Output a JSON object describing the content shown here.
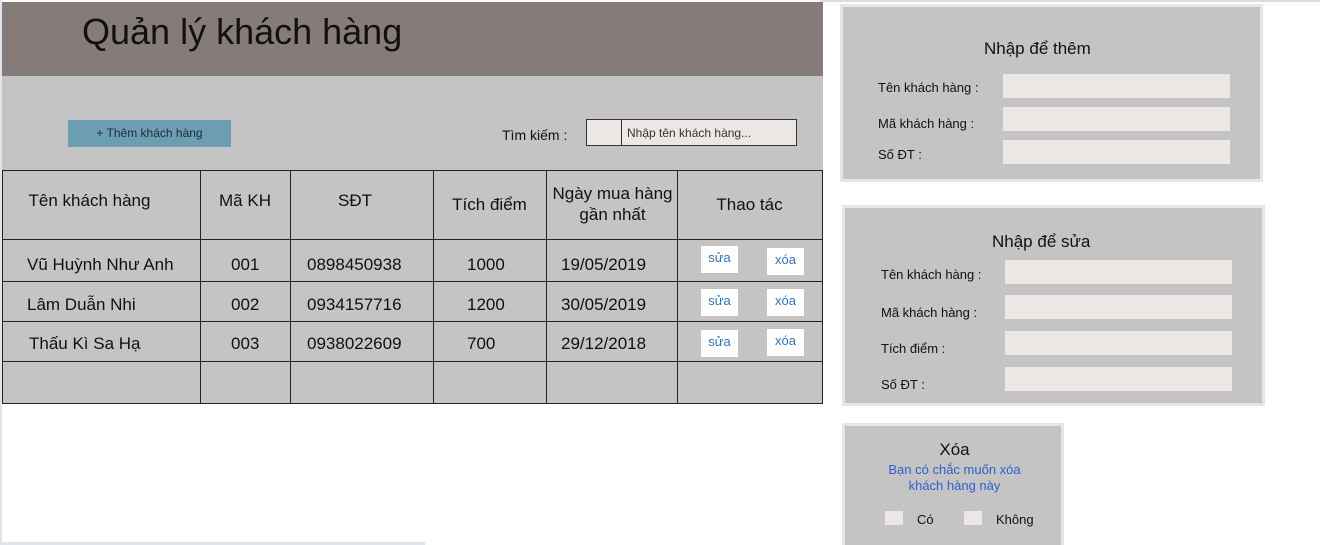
{
  "app": {
    "title": "Quản lý khách hàng"
  },
  "toolbar": {
    "add_label": "+ Thêm khách hàng",
    "search_label": "Tìm kiếm :",
    "search_placeholder": "Nhập tên khách hàng..."
  },
  "table": {
    "columns": [
      "Tên khách hàng",
      "Mã KH",
      "SĐT",
      "Tích điểm",
      "Ngày mua hàng gần nhất",
      "Thao tác"
    ],
    "edit_label": "sửa",
    "delete_label": "xóa",
    "rows": [
      {
        "name": "Vũ Huỳnh Như Anh",
        "code": "001",
        "phone": "0898450938",
        "points": "1000",
        "date": "19/05/2019"
      },
      {
        "name": "Lâm Duẫn Nhi",
        "code": "002",
        "phone": "0934157716",
        "points": "1200",
        "date": "30/05/2019"
      },
      {
        "name": "Thấu Kì Sa Hạ",
        "code": "003",
        "phone": "0938022609",
        "points": "700",
        "date": "29/12/2018"
      }
    ]
  },
  "add_form": {
    "title": "Nhập để thêm",
    "name_label": "Tên khách hàng :",
    "code_label": "Mã khách hàng :",
    "phone_label": "Số ĐT :"
  },
  "edit_form": {
    "title": "Nhập để sửa",
    "name_label": "Tên khách hàng :",
    "code_label": "Mã khách hàng :",
    "points_label": "Tích điểm :",
    "phone_label": "Số ĐT :"
  },
  "delete_dialog": {
    "title": "Xóa",
    "message_line1": "Bạn có chắc muốn xóa",
    "message_line2": "khách hàng này",
    "yes_label": "Có",
    "no_label": "Không"
  }
}
